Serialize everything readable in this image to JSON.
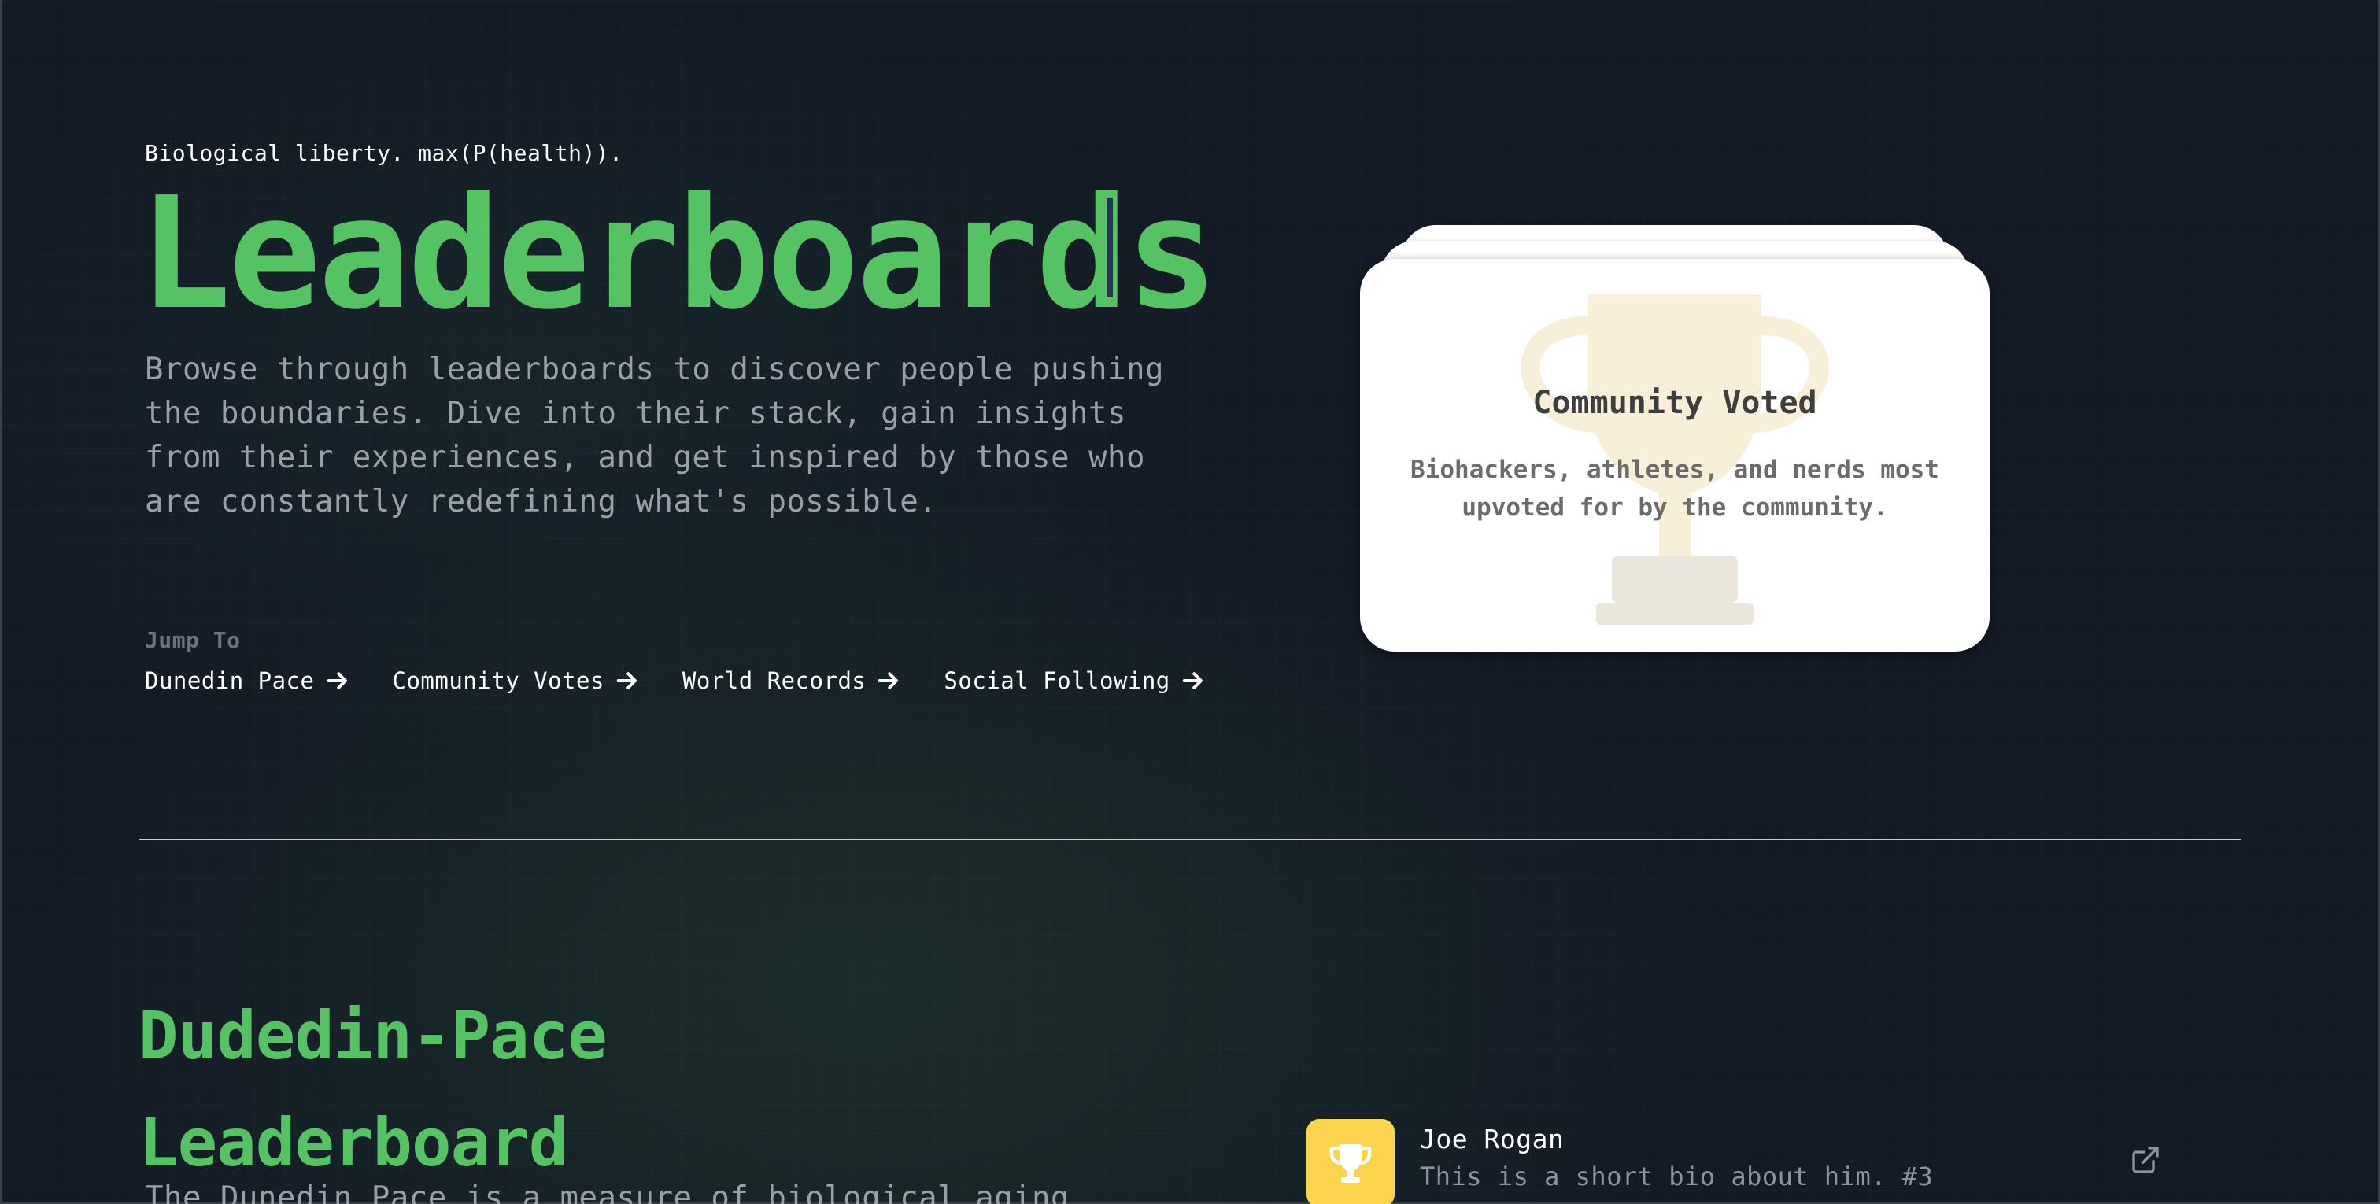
{
  "hero": {
    "tagline": "Biological liberty. max(P(health)).",
    "title": "Leaderboards",
    "description": "Browse through leaderboards to discover people pushing the boundaries. Dive into their stack, gain insights from their experiences, and get inspired by those who are constantly redefining what's possible."
  },
  "jump_to": {
    "label": "Jump To",
    "links": [
      {
        "label": "Dunedin Pace",
        "icon": "arrow-right-icon"
      },
      {
        "label": "Community Votes",
        "icon": "arrow-right-icon"
      },
      {
        "label": "World Records",
        "icon": "arrow-right-icon"
      },
      {
        "label": "Social Following",
        "icon": "arrow-right-icon"
      }
    ]
  },
  "feature_card": {
    "title": "Community Voted",
    "description": "Biohackers, athletes, and nerds most upvoted for by the community.",
    "background_icon": "trophy-icon"
  },
  "section": {
    "title": "Dudedin-Pace Leaderboard",
    "description": "The Dunedin Pace is a measure of biological aging"
  },
  "entries": [
    {
      "name": "Joe Rogan",
      "bio": "This is a short bio about him. #3",
      "badge_icon": "trophy-icon",
      "link_icon": "external-link-icon"
    }
  ],
  "colors": {
    "accent_green": "#55c263",
    "badge_yellow": "#fcd34d",
    "background": "#141b26"
  }
}
